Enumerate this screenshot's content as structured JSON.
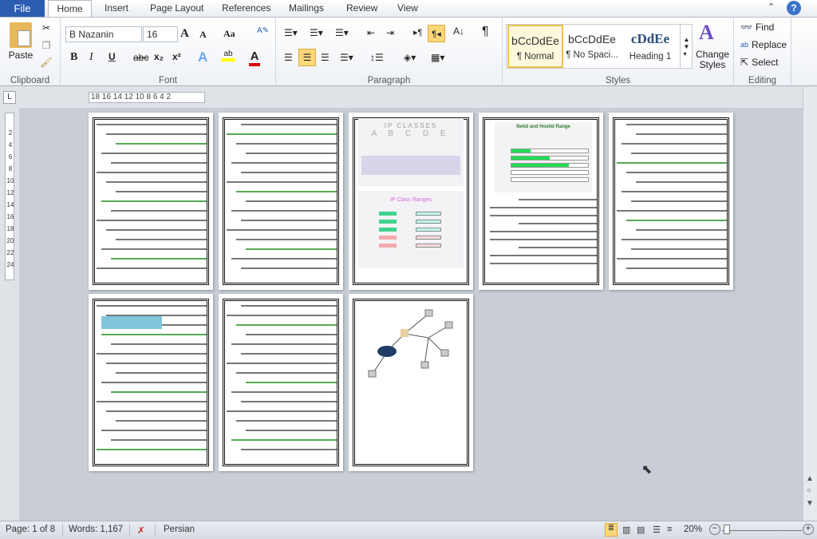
{
  "tabs": {
    "file": "File",
    "items": [
      "Home",
      "Insert",
      "Page Layout",
      "References",
      "Mailings",
      "Review",
      "View"
    ]
  },
  "clipboard": {
    "paste": "Paste",
    "label": "Clipboard"
  },
  "font": {
    "name": "B Nazanin",
    "size": "16",
    "label": "Font",
    "bold": "B",
    "italic": "I",
    "underline": "U",
    "strike": "abc",
    "sub": "x₂",
    "sup": "x²",
    "grow": "A",
    "shrink": "A",
    "case": "Aa"
  },
  "paragraph": {
    "label": "Paragraph",
    "pilcrow": "¶"
  },
  "styles": {
    "label": "Styles",
    "items": [
      {
        "preview": "bCcDdEe",
        "name": "¶ Normal"
      },
      {
        "preview": "bCcDdEe",
        "name": "¶ No Spaci..."
      },
      {
        "preview": "cDdEe",
        "name": "Heading 1"
      }
    ],
    "change": "Change Styles"
  },
  "editing": {
    "label": "Editing",
    "find": "Find",
    "replace": "Replace",
    "select": "Select"
  },
  "ruler": {
    "marks": "18 16 14 12 10 8 6 4 2",
    "vmarks": [
      "2",
      "4",
      "6",
      "8",
      "10",
      "12",
      "14",
      "16",
      "18",
      "20",
      "22",
      "24"
    ]
  },
  "pages": {
    "p3_title": "IP CLASSES",
    "p3_letters": "A B C D E",
    "p3_ranges": "IP Class Ranges",
    "p4_title": "Netid and Hostid Range"
  },
  "status": {
    "page": "Page: 1 of 8",
    "words": "Words: 1,167",
    "language": "Persian",
    "zoom": "20%",
    "zoom_percent": 20
  },
  "colors": {
    "file_tab": "#2a5db0",
    "active": "#fcd77a",
    "doc_bg": "#c9ced6"
  }
}
